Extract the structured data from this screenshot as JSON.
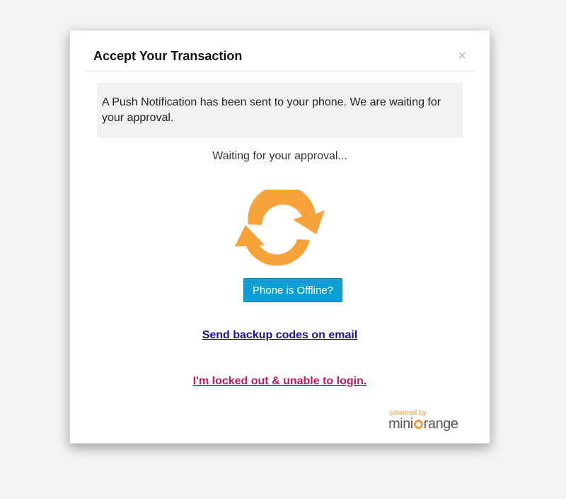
{
  "modal": {
    "title": "Accept Your Transaction",
    "close_label": "×"
  },
  "notice": {
    "text": "A Push Notification has been sent to your phone. We are waiting for your approval."
  },
  "status": {
    "waiting_text": "Waiting for your approval..."
  },
  "actions": {
    "offline_button": "Phone is Offline?",
    "backup_link": "Send backup codes on email",
    "locked_link": "I'm locked out & unable to login."
  },
  "branding": {
    "powered_by": "powered by",
    "brand_left": "mini",
    "brand_right": "range"
  },
  "icons": {
    "sync": "sync-arrows-icon",
    "close": "close-icon"
  },
  "colors": {
    "accent_orange": "#f8a23a",
    "button_blue": "#0aa0d6",
    "link_blue": "#1a0dab",
    "link_pink": "#c2185b"
  }
}
